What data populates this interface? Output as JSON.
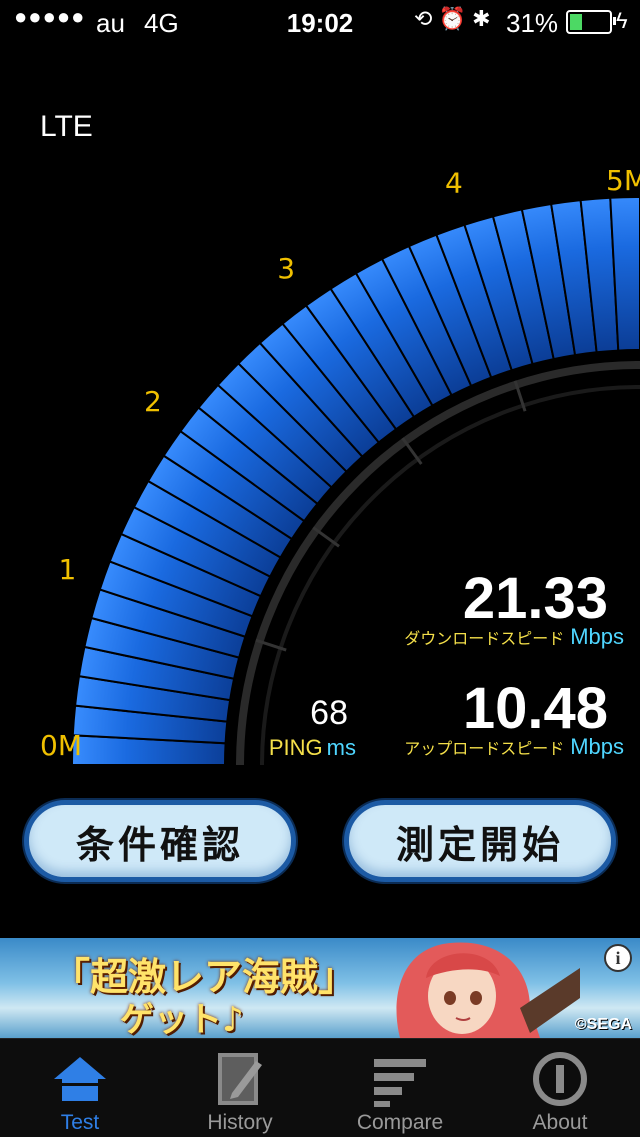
{
  "status_bar": {
    "signal": "●●●●●",
    "carrier": "au",
    "network": "4G",
    "time": "19:02",
    "battery_percent": "31%",
    "battery_level": 0.31
  },
  "connection_type": "LTE",
  "gauge": {
    "tick_labels": [
      "0M",
      "1",
      "2",
      "3",
      "4",
      "5M"
    ],
    "max_value": 5,
    "value": 5
  },
  "download": {
    "value": "21.33",
    "label": "ダウンロードスピード",
    "unit": "Mbps"
  },
  "upload": {
    "value": "10.48",
    "label": "アップロードスピード",
    "unit": "Mbps"
  },
  "ping": {
    "value": "68",
    "label": "PING",
    "unit": "ms"
  },
  "buttons": {
    "conditions": "条件確認",
    "start": "測定開始"
  },
  "ad": {
    "headline": "「超激レア海賊」",
    "subline": "ゲット♪",
    "copyright": "©SEGA",
    "info": "i"
  },
  "tabs": [
    {
      "label": "Test",
      "icon": "home-icon",
      "active": true
    },
    {
      "label": "History",
      "icon": "notepad-icon",
      "active": false
    },
    {
      "label": "Compare",
      "icon": "bars-icon",
      "active": false
    },
    {
      "label": "About",
      "icon": "info-icon",
      "active": false
    }
  ],
  "colors": {
    "accent": "#2f7fe6",
    "tick_label": "#f0c000",
    "jp_label": "#f5e04a",
    "unit": "#4fd6ff"
  }
}
